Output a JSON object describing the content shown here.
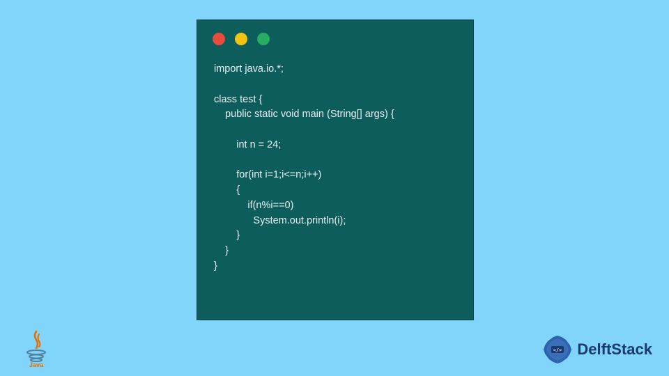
{
  "code": {
    "line1": "import java.io.*;",
    "blank1": "",
    "line2": "class test {",
    "line3": "    public static void main (String[] args) {",
    "blank2": "",
    "line4": "        int n = 24;",
    "blank3": "",
    "line5": "        for(int i=1;i<=n;i++)",
    "line6": "        {",
    "line7": "            if(n%i==0)",
    "line8": "              System.out.println(i);",
    "line9": "        }",
    "line10": "    }",
    "line11": "}"
  },
  "logos": {
    "java_label": "Java",
    "delftstack_label": "DelftStack"
  },
  "window_controls": {
    "red": "close",
    "yellow": "minimize",
    "green": "maximize"
  }
}
